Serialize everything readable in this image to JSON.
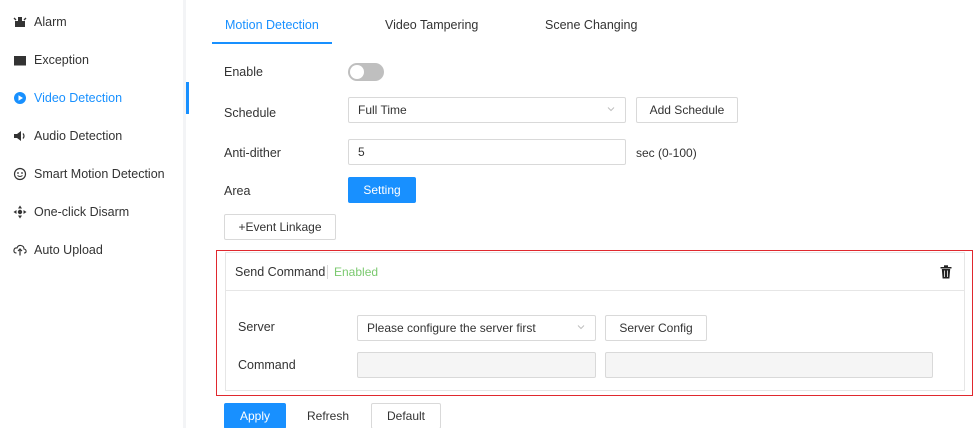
{
  "sidebar": {
    "items": [
      {
        "label": "Alarm",
        "icon": "alarm-icon"
      },
      {
        "label": "Exception",
        "icon": "exception-icon"
      },
      {
        "label": "Video Detection",
        "icon": "video-detection-icon",
        "active": true
      },
      {
        "label": "Audio Detection",
        "icon": "audio-icon"
      },
      {
        "label": "Smart Motion Detection",
        "icon": "smart-motion-icon"
      },
      {
        "label": "One-click Disarm",
        "icon": "disarm-icon"
      },
      {
        "label": "Auto Upload",
        "icon": "upload-icon"
      }
    ]
  },
  "tabs": [
    {
      "label": "Motion Detection",
      "active": true
    },
    {
      "label": "Video Tampering"
    },
    {
      "label": "Scene Changing"
    }
  ],
  "form": {
    "enable_label": "Enable",
    "enable_value": false,
    "schedule_label": "Schedule",
    "schedule_value": "Full Time",
    "add_schedule_label": "Add Schedule",
    "antidither_label": "Anti-dither",
    "antidither_value": "5",
    "antidither_unit": "sec (0-100)",
    "area_label": "Area",
    "setting_label": "Setting",
    "event_linkage_label": "+Event Linkage"
  },
  "linkage": {
    "title": "Send Command",
    "status": "Enabled",
    "server_label": "Server",
    "server_placeholder": "Please configure the server first",
    "server_config_label": "Server Config",
    "command_label": "Command"
  },
  "footer": {
    "apply_label": "Apply",
    "refresh_label": "Refresh",
    "default_label": "Default"
  },
  "colors": {
    "accent": "#1890ff",
    "highlight_border": "#e0282e",
    "enabled_text": "#7bc96f"
  }
}
